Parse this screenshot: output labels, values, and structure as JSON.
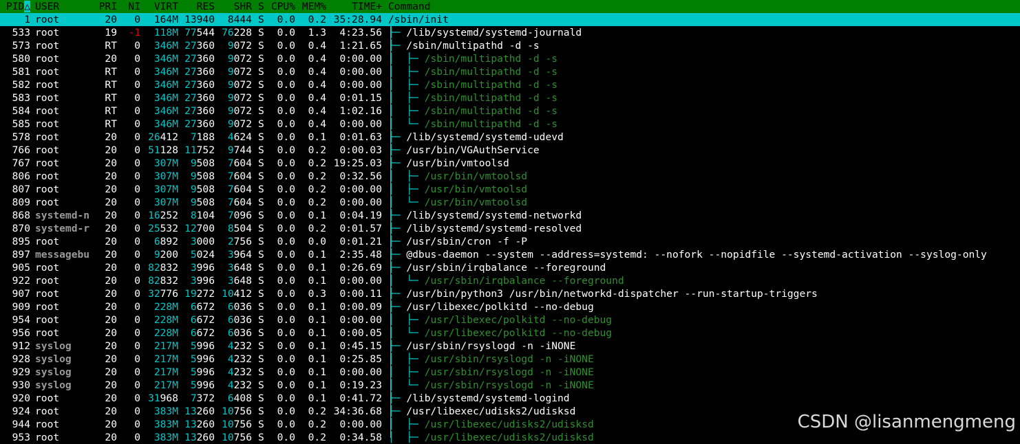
{
  "header": {
    "pid": "PID",
    "sort_marker": "△",
    "user": "USER",
    "pri": "PRI",
    "ni": "NI",
    "virt": "VIRT",
    "res": "RES",
    "shr": "SHR",
    "s": "S",
    "cpu": "CPU%",
    "mem": "MEM%",
    "time": "TIME+",
    "command": "Command"
  },
  "colors": {
    "header_bg": "#008000",
    "selected_bg": "#00c8c8",
    "thread_text": "#2f8f2f",
    "tree_lines": "#00c8c8",
    "negative_nice": "#e00000"
  },
  "processes": [
    {
      "pid": "1",
      "user": "root",
      "pri": "20",
      "ni": "0",
      "virt": "164M",
      "res": "13940",
      "shr": "8444",
      "s": "S",
      "cpu": "0.0",
      "mem": "0.2",
      "time": "35:28.94",
      "tree": "",
      "cmd": "/sbin/init",
      "selected": true
    },
    {
      "pid": "533",
      "user": "root",
      "pri": "19",
      "ni": "-1",
      "virt": "118M",
      "res": "77544",
      "shr": "76228",
      "s": "S",
      "cpu": "0.0",
      "mem": "1.3",
      "time": "4:23.56",
      "tree": "├─ ",
      "cmd": "/lib/systemd/systemd-journald"
    },
    {
      "pid": "573",
      "user": "root",
      "pri": "RT",
      "ni": "0",
      "virt": "346M",
      "res": "27360",
      "shr": "9072",
      "s": "S",
      "cpu": "0.0",
      "mem": "0.4",
      "time": "1:21.65",
      "tree": "├─ ",
      "cmd": "/sbin/multipathd -d -s"
    },
    {
      "pid": "580",
      "user": "root",
      "pri": "20",
      "ni": "0",
      "virt": "346M",
      "res": "27360",
      "shr": "9072",
      "s": "S",
      "cpu": "0.0",
      "mem": "0.4",
      "time": "0:00.00",
      "tree": "│  ├─ ",
      "cmd": "/sbin/multipathd -d -s",
      "thread": true
    },
    {
      "pid": "581",
      "user": "root",
      "pri": "RT",
      "ni": "0",
      "virt": "346M",
      "res": "27360",
      "shr": "9072",
      "s": "S",
      "cpu": "0.0",
      "mem": "0.4",
      "time": "0:00.00",
      "tree": "│  ├─ ",
      "cmd": "/sbin/multipathd -d -s",
      "thread": true
    },
    {
      "pid": "582",
      "user": "root",
      "pri": "RT",
      "ni": "0",
      "virt": "346M",
      "res": "27360",
      "shr": "9072",
      "s": "S",
      "cpu": "0.0",
      "mem": "0.4",
      "time": "0:00.00",
      "tree": "│  ├─ ",
      "cmd": "/sbin/multipathd -d -s",
      "thread": true
    },
    {
      "pid": "583",
      "user": "root",
      "pri": "RT",
      "ni": "0",
      "virt": "346M",
      "res": "27360",
      "shr": "9072",
      "s": "S",
      "cpu": "0.0",
      "mem": "0.4",
      "time": "0:01.15",
      "tree": "│  ├─ ",
      "cmd": "/sbin/multipathd -d -s",
      "thread": true
    },
    {
      "pid": "584",
      "user": "root",
      "pri": "RT",
      "ni": "0",
      "virt": "346M",
      "res": "27360",
      "shr": "9072",
      "s": "S",
      "cpu": "0.0",
      "mem": "0.4",
      "time": "1:02.16",
      "tree": "│  ├─ ",
      "cmd": "/sbin/multipathd -d -s",
      "thread": true
    },
    {
      "pid": "585",
      "user": "root",
      "pri": "RT",
      "ni": "0",
      "virt": "346M",
      "res": "27360",
      "shr": "9072",
      "s": "S",
      "cpu": "0.0",
      "mem": "0.4",
      "time": "0:00.00",
      "tree": "│  └─ ",
      "cmd": "/sbin/multipathd -d -s",
      "thread": true
    },
    {
      "pid": "578",
      "user": "root",
      "pri": "20",
      "ni": "0",
      "virt": "26412",
      "res": "7188",
      "shr": "4624",
      "s": "S",
      "cpu": "0.0",
      "mem": "0.1",
      "time": "0:01.63",
      "tree": "├─ ",
      "cmd": "/lib/systemd/systemd-udevd"
    },
    {
      "pid": "766",
      "user": "root",
      "pri": "20",
      "ni": "0",
      "virt": "51128",
      "res": "11752",
      "shr": "9744",
      "s": "S",
      "cpu": "0.0",
      "mem": "0.2",
      "time": "0:00.03",
      "tree": "├─ ",
      "cmd": "/usr/bin/VGAuthService"
    },
    {
      "pid": "767",
      "user": "root",
      "pri": "20",
      "ni": "0",
      "virt": "307M",
      "res": "9508",
      "shr": "7604",
      "s": "S",
      "cpu": "0.0",
      "mem": "0.2",
      "time": "19:25.03",
      "tree": "├─ ",
      "cmd": "/usr/bin/vmtoolsd"
    },
    {
      "pid": "806",
      "user": "root",
      "pri": "20",
      "ni": "0",
      "virt": "307M",
      "res": "9508",
      "shr": "7604",
      "s": "S",
      "cpu": "0.0",
      "mem": "0.2",
      "time": "0:32.56",
      "tree": "│  ├─ ",
      "cmd": "/usr/bin/vmtoolsd",
      "thread": true
    },
    {
      "pid": "807",
      "user": "root",
      "pri": "20",
      "ni": "0",
      "virt": "307M",
      "res": "9508",
      "shr": "7604",
      "s": "S",
      "cpu": "0.0",
      "mem": "0.2",
      "time": "0:00.00",
      "tree": "│  ├─ ",
      "cmd": "/usr/bin/vmtoolsd",
      "thread": true
    },
    {
      "pid": "809",
      "user": "root",
      "pri": "20",
      "ni": "0",
      "virt": "307M",
      "res": "9508",
      "shr": "7604",
      "s": "S",
      "cpu": "0.0",
      "mem": "0.2",
      "time": "0:00.00",
      "tree": "│  └─ ",
      "cmd": "/usr/bin/vmtoolsd",
      "thread": true
    },
    {
      "pid": "868",
      "user": "systemd-n",
      "pri": "20",
      "ni": "0",
      "virt": "16252",
      "res": "8104",
      "shr": "7096",
      "s": "S",
      "cpu": "0.0",
      "mem": "0.1",
      "time": "0:04.19",
      "tree": "├─ ",
      "cmd": "/lib/systemd/systemd-networkd",
      "grayuser": true
    },
    {
      "pid": "870",
      "user": "systemd-r",
      "pri": "20",
      "ni": "0",
      "virt": "25532",
      "res": "12700",
      "shr": "8504",
      "s": "S",
      "cpu": "0.0",
      "mem": "0.2",
      "time": "0:01.57",
      "tree": "├─ ",
      "cmd": "/lib/systemd/systemd-resolved",
      "grayuser": true
    },
    {
      "pid": "895",
      "user": "root",
      "pri": "20",
      "ni": "0",
      "virt": "6892",
      "res": "3000",
      "shr": "2756",
      "s": "S",
      "cpu": "0.0",
      "mem": "0.0",
      "time": "0:01.21",
      "tree": "├─ ",
      "cmd": "/usr/sbin/cron -f -P"
    },
    {
      "pid": "897",
      "user": "messagebu",
      "pri": "20",
      "ni": "0",
      "virt": "9200",
      "res": "5024",
      "shr": "3964",
      "s": "S",
      "cpu": "0.0",
      "mem": "0.1",
      "time": "2:35.48",
      "tree": "├─ ",
      "cmd": "@dbus-daemon --system --address=systemd: --nofork --nopidfile --systemd-activation --syslog-only",
      "grayuser": true
    },
    {
      "pid": "905",
      "user": "root",
      "pri": "20",
      "ni": "0",
      "virt": "82832",
      "res": "3996",
      "shr": "3648",
      "s": "S",
      "cpu": "0.0",
      "mem": "0.1",
      "time": "0:26.69",
      "tree": "├─ ",
      "cmd": "/usr/sbin/irqbalance --foreground"
    },
    {
      "pid": "922",
      "user": "root",
      "pri": "20",
      "ni": "0",
      "virt": "82832",
      "res": "3996",
      "shr": "3648",
      "s": "S",
      "cpu": "0.0",
      "mem": "0.1",
      "time": "0:00.00",
      "tree": "│  └─ ",
      "cmd": "/usr/sbin/irqbalance --foreground",
      "thread": true
    },
    {
      "pid": "907",
      "user": "root",
      "pri": "20",
      "ni": "0",
      "virt": "32776",
      "res": "19272",
      "shr": "10412",
      "s": "S",
      "cpu": "0.0",
      "mem": "0.3",
      "time": "0:00.11",
      "tree": "├─ ",
      "cmd": "/usr/bin/python3 /usr/bin/networkd-dispatcher --run-startup-triggers"
    },
    {
      "pid": "909",
      "user": "root",
      "pri": "20",
      "ni": "0",
      "virt": "228M",
      "res": "6672",
      "shr": "6036",
      "s": "S",
      "cpu": "0.0",
      "mem": "0.1",
      "time": "0:00.09",
      "tree": "├─ ",
      "cmd": "/usr/libexec/polkitd --no-debug"
    },
    {
      "pid": "954",
      "user": "root",
      "pri": "20",
      "ni": "0",
      "virt": "228M",
      "res": "6672",
      "shr": "6036",
      "s": "S",
      "cpu": "0.0",
      "mem": "0.1",
      "time": "0:00.00",
      "tree": "│  ├─ ",
      "cmd": "/usr/libexec/polkitd --no-debug",
      "thread": true
    },
    {
      "pid": "956",
      "user": "root",
      "pri": "20",
      "ni": "0",
      "virt": "228M",
      "res": "6672",
      "shr": "6036",
      "s": "S",
      "cpu": "0.0",
      "mem": "0.1",
      "time": "0:00.05",
      "tree": "│  └─ ",
      "cmd": "/usr/libexec/polkitd --no-debug",
      "thread": true
    },
    {
      "pid": "912",
      "user": "syslog",
      "pri": "20",
      "ni": "0",
      "virt": "217M",
      "res": "5996",
      "shr": "4232",
      "s": "S",
      "cpu": "0.0",
      "mem": "0.1",
      "time": "0:45.15",
      "tree": "├─ ",
      "cmd": "/usr/sbin/rsyslogd -n -iNONE",
      "grayuser": true
    },
    {
      "pid": "928",
      "user": "syslog",
      "pri": "20",
      "ni": "0",
      "virt": "217M",
      "res": "5996",
      "shr": "4232",
      "s": "S",
      "cpu": "0.0",
      "mem": "0.1",
      "time": "0:25.85",
      "tree": "│  ├─ ",
      "cmd": "/usr/sbin/rsyslogd -n -iNONE",
      "thread": true,
      "grayuser": true
    },
    {
      "pid": "929",
      "user": "syslog",
      "pri": "20",
      "ni": "0",
      "virt": "217M",
      "res": "5996",
      "shr": "4232",
      "s": "S",
      "cpu": "0.0",
      "mem": "0.1",
      "time": "0:00.00",
      "tree": "│  ├─ ",
      "cmd": "/usr/sbin/rsyslogd -n -iNONE",
      "thread": true,
      "grayuser": true
    },
    {
      "pid": "930",
      "user": "syslog",
      "pri": "20",
      "ni": "0",
      "virt": "217M",
      "res": "5996",
      "shr": "4232",
      "s": "S",
      "cpu": "0.0",
      "mem": "0.1",
      "time": "0:19.23",
      "tree": "│  └─ ",
      "cmd": "/usr/sbin/rsyslogd -n -iNONE",
      "thread": true,
      "grayuser": true
    },
    {
      "pid": "920",
      "user": "root",
      "pri": "20",
      "ni": "0",
      "virt": "31968",
      "res": "7372",
      "shr": "6408",
      "s": "S",
      "cpu": "0.0",
      "mem": "0.1",
      "time": "0:41.72",
      "tree": "├─ ",
      "cmd": "/lib/systemd/systemd-logind"
    },
    {
      "pid": "924",
      "user": "root",
      "pri": "20",
      "ni": "0",
      "virt": "383M",
      "res": "13260",
      "shr": "10756",
      "s": "S",
      "cpu": "0.0",
      "mem": "0.2",
      "time": "34:36.68",
      "tree": "├─ ",
      "cmd": "/usr/libexec/udisks2/udisksd"
    },
    {
      "pid": "944",
      "user": "root",
      "pri": "20",
      "ni": "0",
      "virt": "383M",
      "res": "13260",
      "shr": "10756",
      "s": "S",
      "cpu": "0.0",
      "mem": "0.2",
      "time": "0:00.00",
      "tree": "│  ├─ ",
      "cmd": "/usr/libexec/udisks2/udisksd",
      "thread": true
    },
    {
      "pid": "953",
      "user": "root",
      "pri": "20",
      "ni": "0",
      "virt": "383M",
      "res": "13260",
      "shr": "10756",
      "s": "S",
      "cpu": "0.0",
      "mem": "0.2",
      "time": "0:34.58",
      "tree": "│  ├─ ",
      "cmd": "/usr/libexec/udisks2/udisksd",
      "thread": true
    }
  ],
  "watermark": "CSDN @lisanmengmeng"
}
